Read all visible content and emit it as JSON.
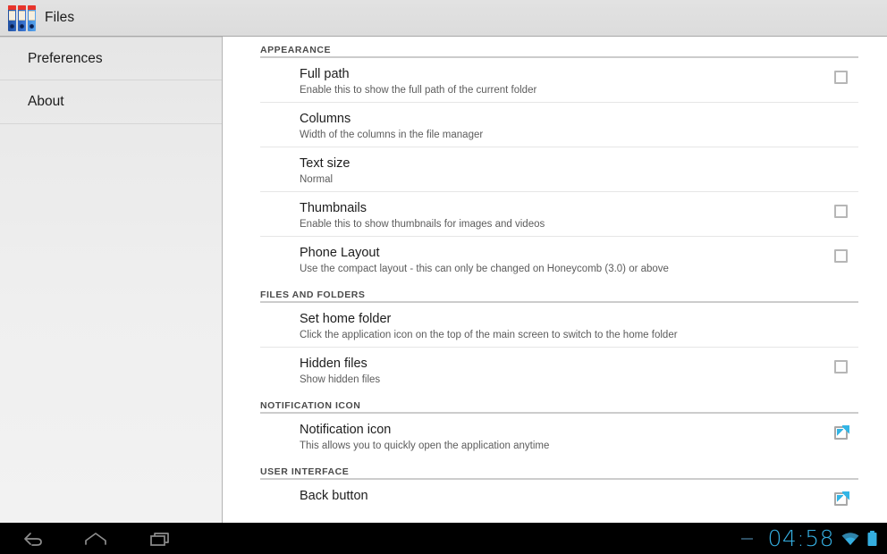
{
  "app": {
    "title": "Files",
    "icon": "files-binders-icon"
  },
  "sidebar": {
    "items": [
      {
        "label": "Preferences",
        "name": "sidebar-item-preferences",
        "selected": true
      },
      {
        "label": "About",
        "name": "sidebar-item-about",
        "selected": false
      }
    ]
  },
  "colors": {
    "accent_blue": "#33b5e5",
    "status_blue": "#35aee0",
    "titlebar_bg": "#dcdcdc",
    "sidebar_bg": "#ebebeb",
    "navbar_bg": "#000000",
    "divider": "#e6e6e6",
    "section_rule": "#cccccc"
  },
  "sections": [
    {
      "header": "APPEARANCE",
      "rows": [
        {
          "title": "Full path",
          "summary": "Enable this to show the full path of the current folder",
          "widget": "checkbox",
          "checked": false
        },
        {
          "title": "Columns",
          "summary": "Width of the columns in the file manager",
          "widget": "none",
          "checked": null
        },
        {
          "title": "Text size",
          "summary": "Normal",
          "widget": "none",
          "checked": null
        },
        {
          "title": "Thumbnails",
          "summary": "Enable this to show thumbnails for images and videos",
          "widget": "checkbox",
          "checked": false
        },
        {
          "title": "Phone Layout",
          "summary": "Use the compact layout - this can only be changed on Honeycomb (3.0) or above",
          "widget": "checkbox",
          "checked": false
        }
      ]
    },
    {
      "header": "FILES AND FOLDERS",
      "rows": [
        {
          "title": "Set home folder",
          "summary": "Click the application icon on the top of the main screen to switch to the home folder",
          "widget": "none",
          "checked": null
        },
        {
          "title": "Hidden files",
          "summary": "Show hidden files",
          "widget": "checkbox",
          "checked": false
        }
      ]
    },
    {
      "header": "NOTIFICATION ICON",
      "rows": [
        {
          "title": "Notification icon",
          "summary": "This allows you to quickly open the application anytime",
          "widget": "checkbox",
          "checked": true
        }
      ]
    },
    {
      "header": "USER INTERFACE",
      "rows": [
        {
          "title": "Back button",
          "summary": "",
          "widget": "checkbox",
          "checked": true
        }
      ]
    }
  ],
  "navbar": {
    "buttons": [
      {
        "name": "back-icon",
        "label": "Back"
      },
      {
        "name": "home-icon",
        "label": "Home"
      },
      {
        "name": "recents-icon",
        "label": "Recent apps"
      }
    ],
    "status": {
      "dash": "—",
      "clock": "04:58",
      "wifi_icon": "wifi-icon",
      "battery_icon": "battery-icon"
    }
  }
}
